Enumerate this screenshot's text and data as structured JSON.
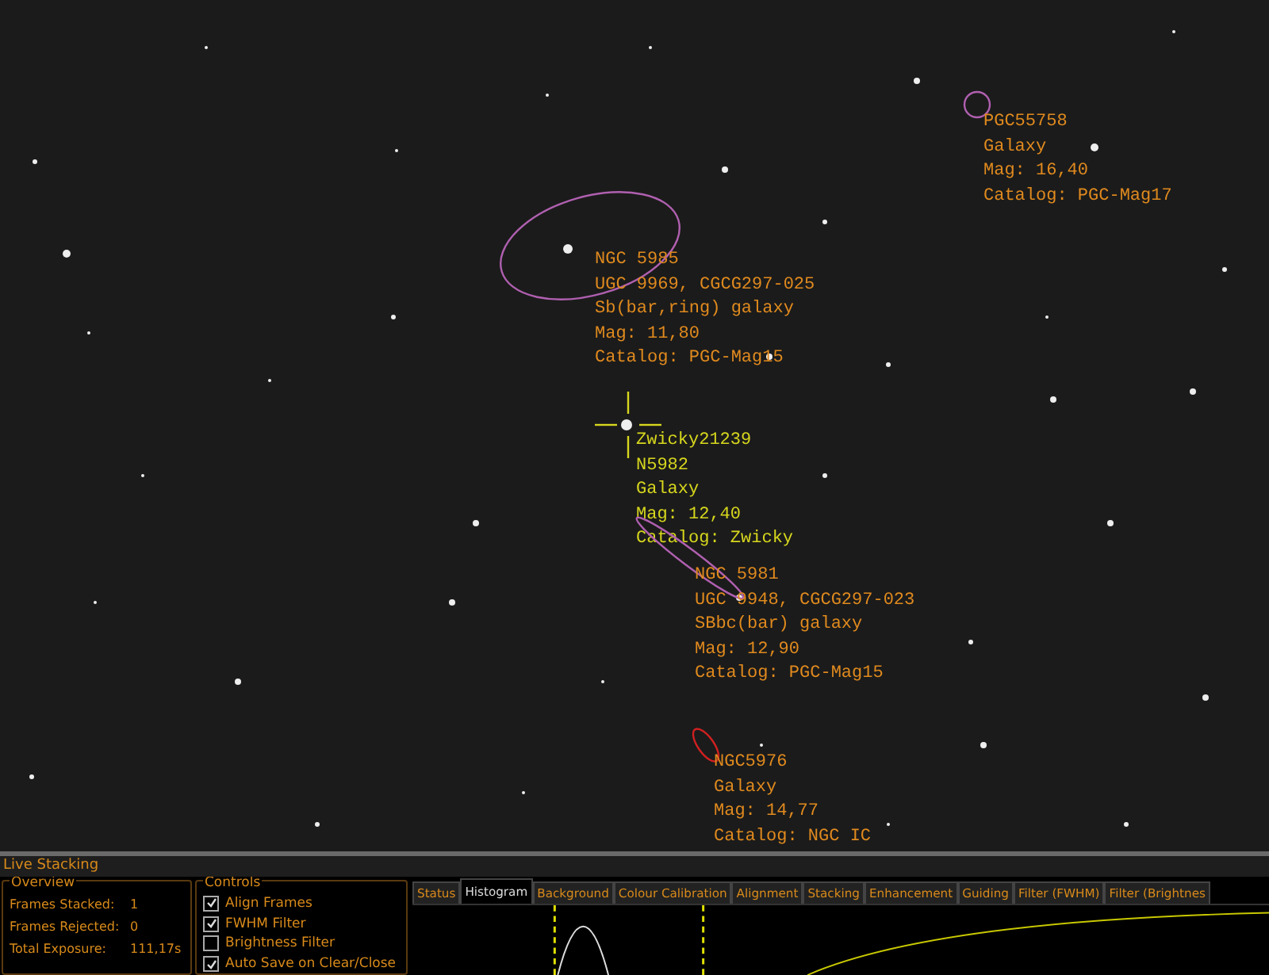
{
  "annotations": [
    {
      "kind": "circle",
      "color": "#b060b0",
      "lines": [
        "PGC55758",
        "Galaxy",
        "Mag: 16,40",
        "Catalog: PGC-Mag17"
      ]
    },
    {
      "kind": "ellipse",
      "color": "#b060b0",
      "lines": [
        "NGC 5985",
        "UGC 9969, CGCG297-025",
        "Sb(bar,ring) galaxy",
        "Mag: 11,80",
        "Catalog: PGC-Mag15"
      ]
    },
    {
      "kind": "crosshair",
      "color": "#d6d61e",
      "lines": [
        "Zwicky21239",
        "N5982",
        "Galaxy",
        "Mag: 12,40",
        "Catalog: Zwicky"
      ]
    },
    {
      "kind": "ellipse",
      "color": "#b060b0",
      "lines": [
        "NGC 5981",
        "UGC 9948, CGCG297-023",
        "SBbc(bar) galaxy",
        "Mag: 12,90",
        "Catalog: PGC-Mag15"
      ]
    },
    {
      "kind": "ellipse",
      "color": "#d02020",
      "lines": [
        "NGC5976",
        "Galaxy",
        "Mag: 14,77",
        "Catalog: NGC IC"
      ]
    }
  ],
  "panel": {
    "title": "Live Stacking",
    "overview": {
      "title": "Overview",
      "rows": [
        {
          "label": "Frames Stacked:",
          "value": "1"
        },
        {
          "label": "Frames Rejected:",
          "value": "0"
        },
        {
          "label": "Total Exposure:",
          "value": "111,17s"
        }
      ]
    },
    "controls": {
      "title": "Controls",
      "items": [
        {
          "label": "Align Frames",
          "checked": true
        },
        {
          "label": "FWHM Filter",
          "checked": true
        },
        {
          "label": "Brightness Filter",
          "checked": false
        },
        {
          "label": "Auto Save on Clear/Close",
          "checked": true
        }
      ]
    },
    "tabs": [
      {
        "label": "Status",
        "selected": false
      },
      {
        "label": "Histogram",
        "selected": true
      },
      {
        "label": "Background",
        "selected": false
      },
      {
        "label": "Colour Calibration",
        "selected": false
      },
      {
        "label": "Alignment",
        "selected": false
      },
      {
        "label": "Stacking",
        "selected": false
      },
      {
        "label": "Enhancement",
        "selected": false
      },
      {
        "label": "Guiding",
        "selected": false
      },
      {
        "label": "Filter (FWHM)",
        "selected": false
      },
      {
        "label": "Filter (Brightnes",
        "selected": false
      }
    ]
  }
}
